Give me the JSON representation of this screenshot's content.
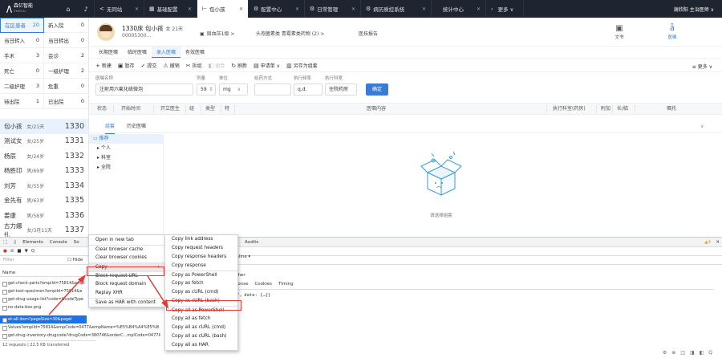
{
  "brand": {
    "name": "森亿智能",
    "sub": "SYNYI.AI"
  },
  "tabs": [
    {
      "label": "无同站",
      "icon": "<"
    },
    {
      "label": "基础配置",
      "icon": "▦"
    },
    {
      "label": "包小孩",
      "icon": "⊢",
      "active": true
    },
    {
      "label": "配置中心",
      "icon": "⚙"
    },
    {
      "label": "日常管理",
      "icon": "⚙"
    },
    {
      "label": "病历质控系统",
      "icon": "⚙"
    },
    {
      "label": "统计中心",
      "icon": ""
    }
  ],
  "more_tab": "更多 ∨",
  "user": "谢欣阳 主治医师 ∨",
  "stats": [
    [
      {
        "label": "在区患者",
        "value": "20",
        "hl": true
      },
      {
        "label": "新入院",
        "value": "0"
      }
    ],
    [
      {
        "label": "当日转入",
        "value": "0"
      },
      {
        "label": "当日转出",
        "value": "0"
      }
    ],
    [
      {
        "label": "手术",
        "value": "3"
      },
      {
        "label": "会诊",
        "value": "2"
      }
    ],
    [
      {
        "label": "死亡",
        "value": "0"
      },
      {
        "label": "一级护理",
        "value": "2"
      }
    ],
    [
      {
        "label": "二级护理",
        "value": "3"
      },
      {
        "label": "危重",
        "value": "0"
      }
    ],
    [
      {
        "label": "待出院",
        "value": "1"
      },
      {
        "label": "已出院",
        "value": "0"
      }
    ]
  ],
  "patients": [
    {
      "name": "包小孩",
      "info": "女/21天",
      "bed": "1330",
      "sel": true
    },
    {
      "name": "测试女",
      "info": "女/25岁",
      "bed": "1331"
    },
    {
      "name": "杨辰",
      "info": "女/24岁",
      "bed": "1332"
    },
    {
      "name": "杨胜印",
      "info": "男/69岁",
      "bed": "1333"
    },
    {
      "name": "刘芳",
      "info": "女/55岁",
      "bed": "1334"
    },
    {
      "name": "金先有",
      "info": "男/63岁",
      "bed": "1335"
    },
    {
      "name": "姜康",
      "info": "男/58岁",
      "bed": "1336"
    },
    {
      "name": "古力娜扎",
      "info": "女/3月11天",
      "bed": "1337"
    },
    {
      "name": "测试22",
      "info": "女/25岁",
      "bed": "1338"
    }
  ],
  "patient_header": {
    "name": "1330床 包小孩",
    "age": "女 21天",
    "id": "00005300...",
    "nursing": "周血压1级 >",
    "diag": "头孢菌素类 青霉素类药物",
    "diag_count": "(2) >",
    "report": "医技报告",
    "doc_label": "文书",
    "order_label": "医嘱"
  },
  "order_tabs": [
    "长期医嘱",
    "临时医嘱",
    "录入医嘱",
    "有效医嘱"
  ],
  "toolbar": [
    {
      "icon": "+",
      "label": "新建"
    },
    {
      "icon": "▣",
      "label": "暂存"
    },
    {
      "icon": "✓",
      "label": "提交"
    },
    {
      "icon": "⚠",
      "label": "撤销"
    },
    {
      "icon": "✂",
      "label": "拆组"
    },
    {
      "icon": "◧",
      "label": "组合",
      "dis": true
    },
    {
      "icon": "↻",
      "label": "刷新"
    },
    {
      "icon": "▤",
      "label": "申请单 ∨"
    },
    {
      "icon": "▥",
      "label": "另存为组套"
    }
  ],
  "toolbar_more": "≡ 更多 ∨",
  "form": {
    "name_label": "医嘱名称",
    "name_value": "注射用六氟化硫微泡",
    "dose_label": "剂量",
    "dose_value": "59",
    "unit_label": "单位",
    "unit_value": "mg",
    "method_label": "给药方式",
    "freq_label": "执行频率",
    "freq_value": "q.d.",
    "dept_label": "执行科室",
    "dept_value": "住院药房",
    "confirm": "确定"
  },
  "table_headers": [
    "状态",
    "开始时间",
    "开立医生",
    "组",
    "类型",
    "特",
    "医嘱内容",
    "执行科室(药房)",
    "附加",
    "长/临",
    "嘱托"
  ],
  "lower_tabs": [
    "组套",
    "历史医嘱"
  ],
  "tree": [
    "推荐",
    "个人",
    "科室",
    "全院"
  ],
  "empty_text": "请选择组套",
  "devtools": {
    "tabs": [
      "Elements",
      "Console",
      "So",
      "ty",
      "Audits"
    ],
    "warn": "▲4",
    "filter": "Filter",
    "hide": "Hide",
    "online": "Online ▾",
    "other": "Other",
    "resp_tabs": [
      "sponse",
      "Cookies",
      "Timing"
    ],
    "resp_text": "功\"，date: {…}}",
    "name_col": "Name",
    "requests": [
      "get-check-parts?empiId=75814&empl",
      "get-test-specimen?empiId=75814&e",
      "get-drug-usage-list?code=&codeType",
      "no-data-box.png",
      "et-all-item?pageSize=30&pagel",
      "Values?empiId=75814&empCode=0477&empName=%E5%B4%A4%E5%B",
      "get-drug-inventory-drugcode?drugCode=380746&orderC...mplCode=0477&"
    ],
    "status": "12 requests | 22.5 KB transferred"
  },
  "context_menu": [
    "Open in new tab",
    "Clear browser cache",
    "Clear browser cookies",
    "Copy",
    "Block request URL",
    "Block request domain",
    "Replay XHR",
    "Save as HAR with content"
  ],
  "copy_menu": [
    "Copy link address",
    "Copy request headers",
    "Copy response headers",
    "Copy response",
    "Copy as PowerShell",
    "Copy as fetch",
    "Copy as cURL (cmd)",
    "Copy as cURL (bash)",
    "Copy all as PowerShell",
    "Copy all as fetch",
    "Copy all as cURL (cmd)",
    "Copy all as cURL (bash)",
    "Copy all as HAR"
  ]
}
